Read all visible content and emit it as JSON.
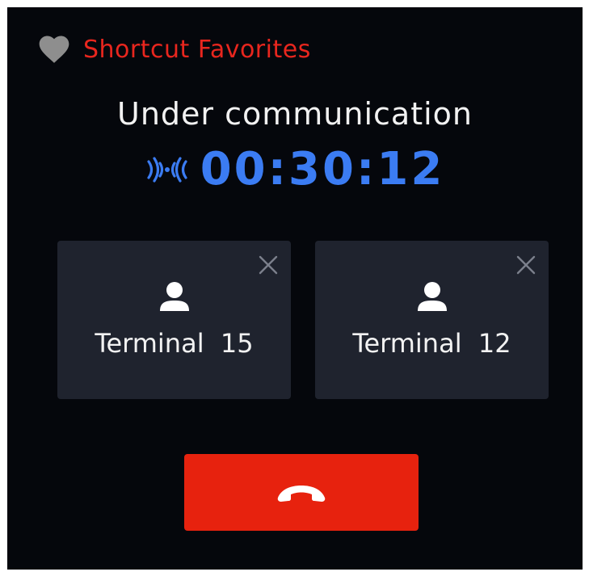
{
  "favorites": {
    "label": "Shortcut Favorites",
    "icon": "heart-icon",
    "icon_color": "#8e8e8e",
    "label_color": "#e8261e"
  },
  "call": {
    "status": "Under communication",
    "timer": "00:30:12",
    "signal_icon": "signal-waves-icon",
    "timer_color": "#3b7cf3"
  },
  "terminals": [
    {
      "label": "Terminal  15",
      "icon": "user-icon",
      "close_icon": "close-icon"
    },
    {
      "label": "Terminal  12",
      "icon": "user-icon",
      "close_icon": "close-icon"
    }
  ],
  "hangup": {
    "icon": "phone-hangup-icon",
    "color": "#e7220e"
  },
  "colors": {
    "background": "#05070c",
    "card": "#1f232e",
    "text": "#f2f2f2"
  }
}
